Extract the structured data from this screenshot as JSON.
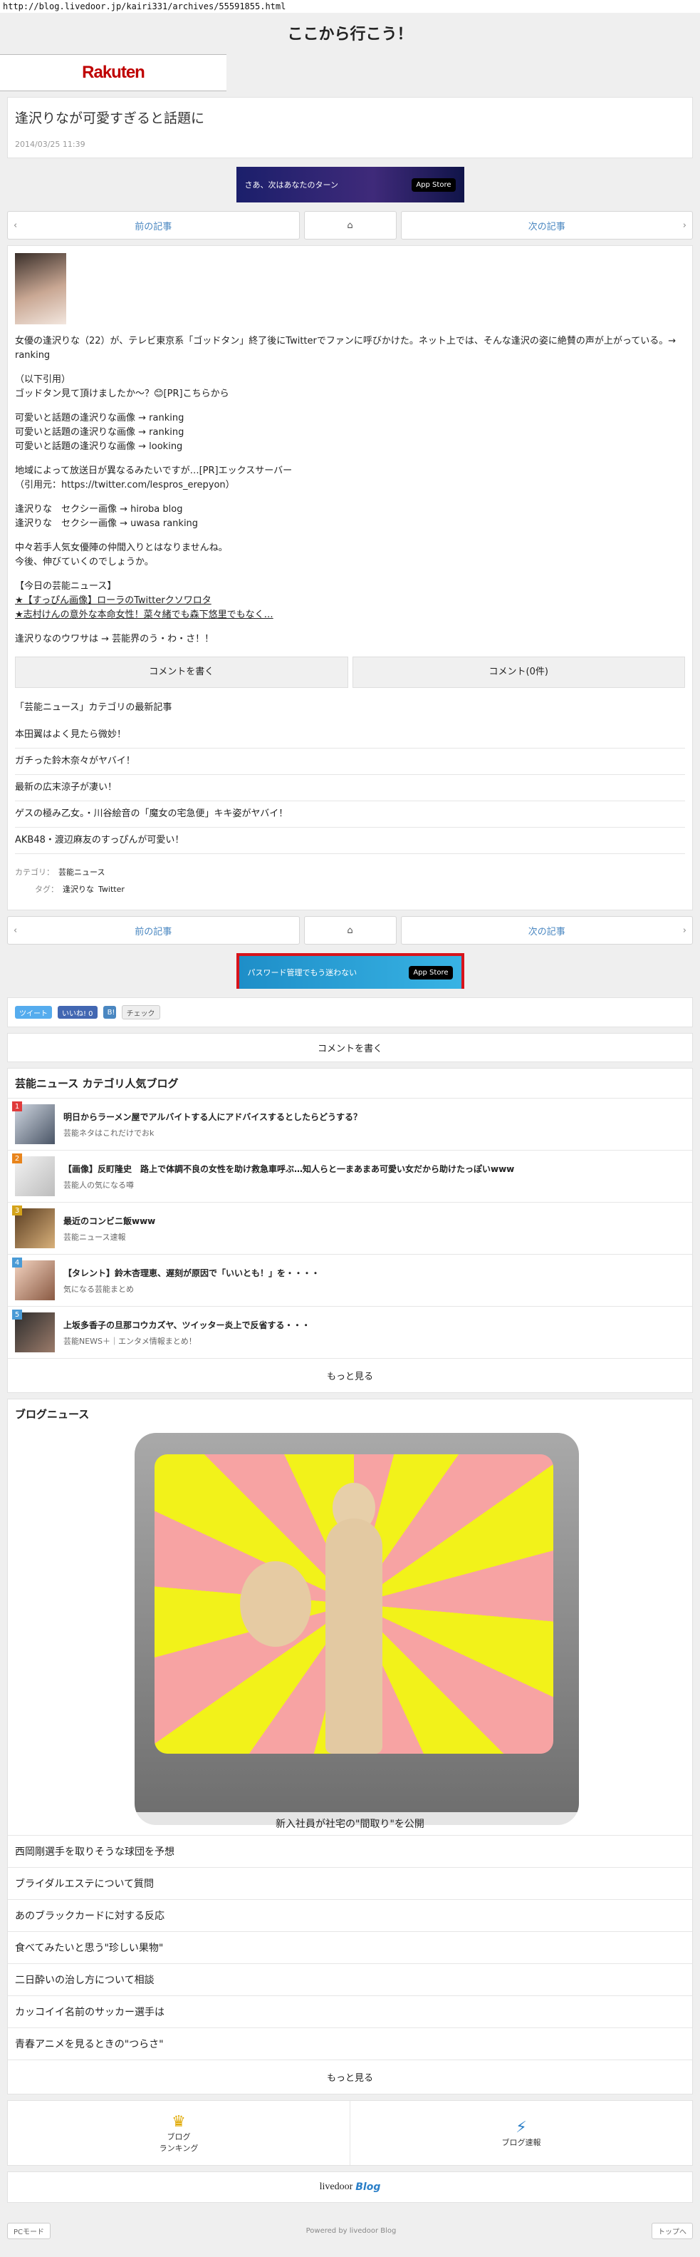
{
  "url": "http://blog.livedoor.jp/kairi331/archives/55591855.html",
  "top_title": "ここから行こう！",
  "rakuten_logo": "Rakuten",
  "article": {
    "title": "逢沢りなが可愛すぎると話題に",
    "date": "2014/03/25 11:39",
    "paragraphs": [
      "女優の逢沢りな（22）が、テレビ東京系「ゴッドタン」終了後にTwitterでファンに呼びかけた。ネット上では、そんな逢沢の姿に絶賛の声が上がっている。→ ranking",
      "（以下引用）",
      "ゴッドタン見て頂けましたか〜？😊[PR]こちらから",
      "可愛いと話題の逢沢りな画像 → ranking",
      "可愛いと話題の逢沢りな画像 → ranking",
      "可愛いと話題の逢沢りな画像 → looking",
      "地域によって放送日が異なるみたいですが…[PR]エックスサーバー",
      "（引用元：https://twitter.com/lespros_erepyon）",
      "逢沢りな　セクシー画像 → hiroba blog",
      "逢沢りな　セクシー画像 → uwasa ranking",
      "中々若手人気女優陣の仲間入りとはなりませんね。",
      "今後、伸びていくのでしょうか。",
      "【今日の芸能ニュース】",
      "★【すっぴん画像】ローラのTwitterクソワロタ",
      "★志村けんの意外な本命女性！菜々緒でも森下悠里でもなく…",
      "逢沢りなのウワサは → 芸能界のう・わ・さ！！"
    ]
  },
  "banner1": {
    "text": "さあ、次はあなたのターン",
    "store": "App Store"
  },
  "banner2": {
    "text": "パスワード管理でもう迷わない",
    "store": "App Store"
  },
  "pager": {
    "prev": "前の記事",
    "next": "次の記事"
  },
  "comment_buttons": {
    "write": "コメントを書く",
    "count": "コメント(0件)"
  },
  "latest": {
    "heading": "「芸能ニュース」カテゴリの最新記事",
    "items": [
      "本田翼はよく見たら微妙！",
      "ガチった鈴木奈々がヤバイ！",
      "最新の広末涼子が凄い！",
      "ゲスの極み乙女。・川谷絵音の「魔女の宅急便」キキ姿がヤバイ！",
      "AKB48・渡辺麻友のすっぴんが可愛い！"
    ]
  },
  "meta": {
    "category_label": "カテゴリ：",
    "category": "芸能ニュース",
    "tag_label": "タグ：",
    "tags": [
      "逢沢りな",
      "Twitter"
    ]
  },
  "social": {
    "tweet": "ツイート",
    "like": "いいね! 0",
    "check": "チェック"
  },
  "write_comment": "コメントを書く",
  "popular": {
    "title": "芸能ニュース カテゴリ人気ブログ",
    "items": [
      {
        "rank": "1",
        "title": "明日からラーメン屋でアルバイトする人にアドバイスするとしたらどうする？",
        "sub": "芸能ネタはこれだけでおk",
        "rank_color": "#e03b3b"
      },
      {
        "rank": "2",
        "title": "【画像】反町隆史　路上で体調不良の女性を助け救急車呼ぶ…知人らと一まあまあ可愛い女だから助けたっぽいwww",
        "sub": "芸能人の気になる噂",
        "rank_color": "#e8841c"
      },
      {
        "rank": "3",
        "title": "最近のコンビニ飯www",
        "sub": "芸能ニュース速報",
        "rank_color": "#d4a31a"
      },
      {
        "rank": "4",
        "title": "【タレント】鈴木杏理恵、遅刻が原因で「いいとも！」を・・・・",
        "sub": "気になる芸能まとめ",
        "rank_color": "#4a9bd6"
      },
      {
        "rank": "5",
        "title": "上坂多香子の旦那コウカズヤ、ツイッター炎上で反省する・・・",
        "sub": "芸能NEWS＋｜エンタメ情報まとめ！",
        "rank_color": "#4a9bd6"
      }
    ],
    "more": "もっと見る"
  },
  "blog_news": {
    "title": "ブログニュース",
    "hero_caption": "新入社員が社宅の\"間取り\"を公開",
    "items": [
      "西岡剛選手を取りそうな球団を予想",
      "ブライダルエステについて質問",
      "あのブラックカードに対する反応",
      "食べてみたいと思う\"珍しい果物\"",
      "二日酔いの治し方について相談",
      "カッコイイ名前のサッカー選手は",
      "青春アニメを見るときの\"つらさ\""
    ],
    "more": "もっと見る"
  },
  "bottom_links": {
    "ranking": "ブログ\nランキング",
    "quick": "ブログ速報"
  },
  "livedoor": {
    "brand": "livedoor",
    "blog": "Blog"
  },
  "footer": {
    "pc_mode": "PCモード",
    "powered": "Powered by livedoor Blog",
    "top": "トップへ"
  },
  "colors": {
    "link_blue": "#4a87c1",
    "rakuten_red": "#bf0000",
    "twitter": "#55acee",
    "facebook": "#4267b2"
  }
}
